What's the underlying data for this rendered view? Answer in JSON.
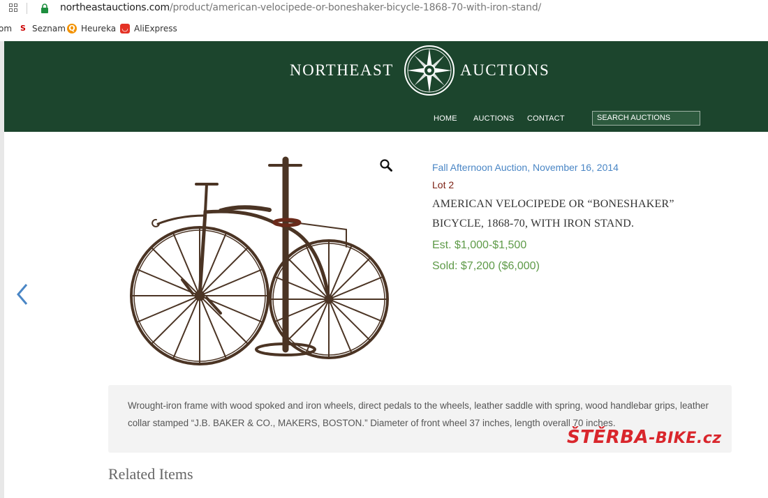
{
  "browser": {
    "url_host": "northeastauctions.com",
    "url_path": "/product/american-velocipede-or-boneshaker-bicycle-1868-70-with-iron-stand/",
    "bookmarks": [
      {
        "label": "om",
        "icon": "truncated"
      },
      {
        "label": "Seznam",
        "icon": "seznam-icon"
      },
      {
        "label": "Heureka",
        "icon": "heureka-icon"
      },
      {
        "label": "AliExpress",
        "icon": "aliexpress-icon"
      }
    ]
  },
  "header": {
    "logo_left": "NORTHEAST",
    "logo_right": "AUCTIONS",
    "nav": [
      "HOME",
      "AUCTIONS",
      "CONTACT"
    ],
    "search_placeholder": "SEARCH AUCTIONS",
    "bg_color": "#1c452d"
  },
  "product": {
    "auction": "Fall Afternoon Auction, November 16, 2014",
    "lot": "Lot 2",
    "title": "AMERICAN VELOCIPEDE OR “BONESHAKER” BICYCLE, 1868-70, WITH IRON STAND.",
    "estimate": "Est. $1,000-$1,500",
    "sold": "Sold: $7,200 ($6,000)",
    "description": "Wrought-iron frame with wood spoked and iron wheels, direct pedals to the wheels, leather saddle with spring, wood handlebar grips, leather collar stamped “J.B. BAKER & CO., MAKERS, BOSTON.” Diameter of front wheel 37 inches, length overall 70 inches."
  },
  "related": {
    "heading": "Related Items"
  },
  "watermark": {
    "main": "ŠTĚRBA",
    "suffix": "-BIKE.cz"
  }
}
